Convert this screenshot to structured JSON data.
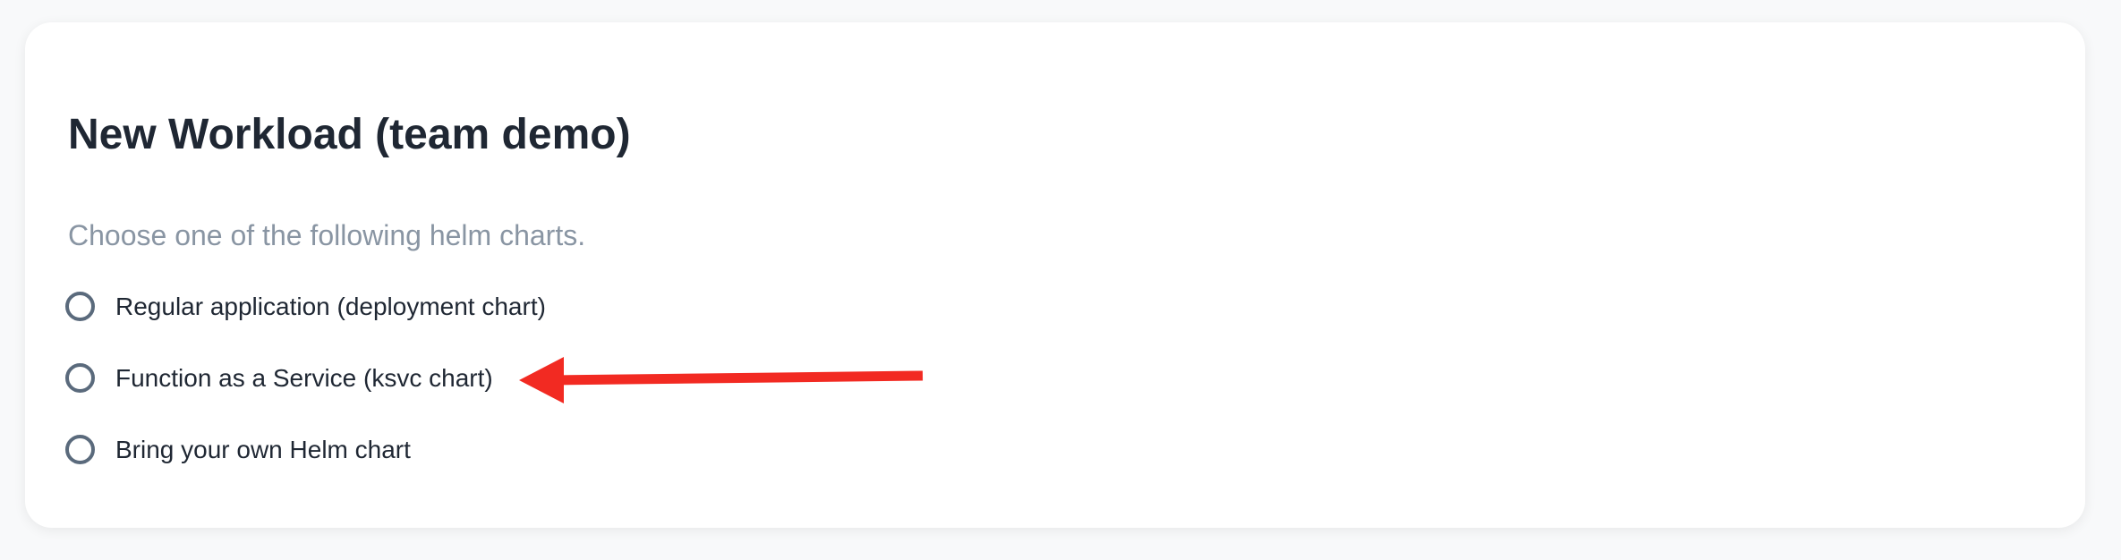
{
  "page": {
    "title": "New Workload (team demo)",
    "subtitle": "Choose one of the following helm charts."
  },
  "options": [
    {
      "label": "Regular application (deployment chart)",
      "selected": false
    },
    {
      "label": "Function as a Service (ksvc chart)",
      "selected": false
    },
    {
      "label": "Bring your own Helm chart",
      "selected": false
    }
  ],
  "colors": {
    "annotation_arrow": "#f22a22",
    "radio_border": "#5a6a7c",
    "title_text": "#1f2733",
    "subtitle_text": "#8995a3"
  }
}
